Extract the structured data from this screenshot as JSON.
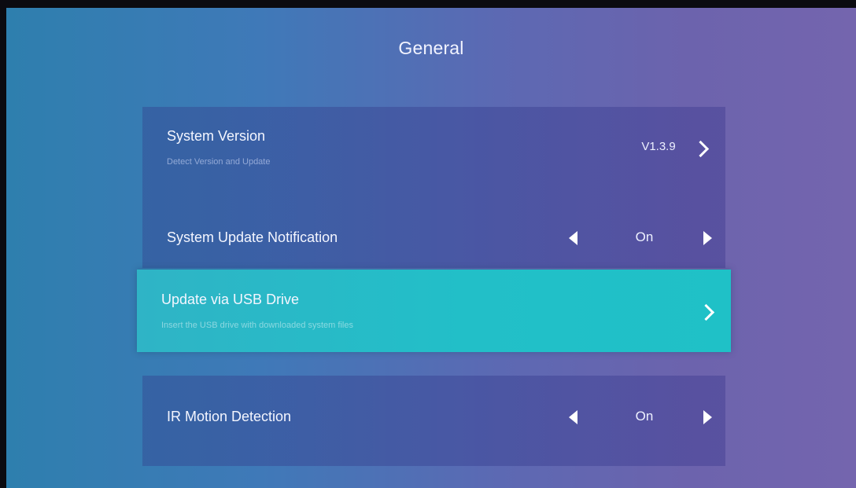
{
  "header": {
    "title": "General"
  },
  "settings": {
    "system_version": {
      "label": "System Version",
      "description": "Detect Version and Update",
      "value": "V1.3.9",
      "icon": "chevron-right-icon"
    },
    "update_notification": {
      "label": "System Update Notification",
      "value": "On",
      "left_icon": "arrow-left-icon",
      "right_icon": "arrow-right-icon"
    },
    "usb_update": {
      "label": "Update via USB Drive",
      "description": "Insert the USB drive with downloaded system files",
      "icon": "chevron-right-icon",
      "selected": true
    },
    "ir_motion": {
      "label": "IR Motion Detection",
      "value": "On",
      "left_icon": "arrow-left-icon",
      "right_icon": "arrow-right-icon"
    }
  },
  "colors": {
    "highlight": "#22bfc8",
    "background_left": "#2e7fae",
    "background_right": "#7465ae"
  }
}
